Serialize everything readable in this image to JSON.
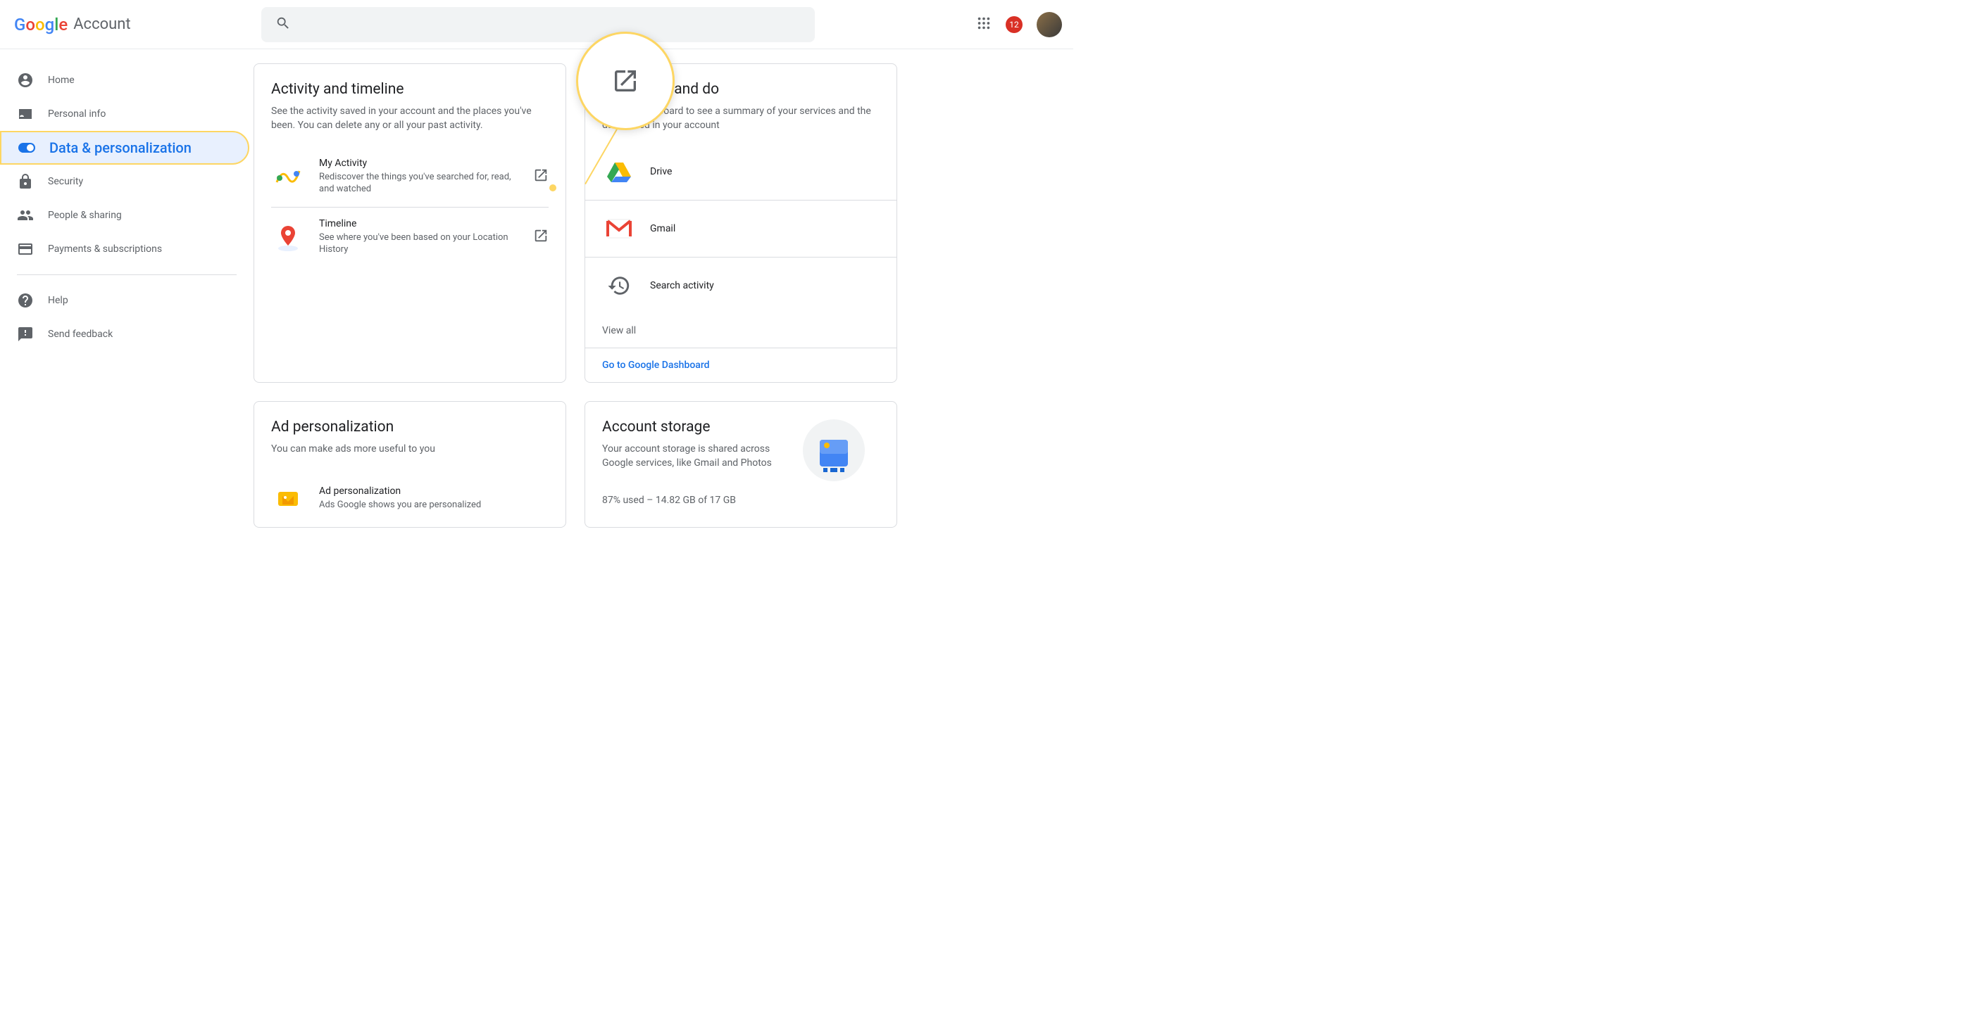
{
  "header": {
    "logo_account": "Account",
    "search_placeholder": "",
    "badge_count": "12"
  },
  "sidebar": {
    "items": [
      {
        "label": "Home"
      },
      {
        "label": "Personal info"
      },
      {
        "label": "Data & personalization"
      },
      {
        "label": "Security"
      },
      {
        "label": "People & sharing"
      },
      {
        "label": "Payments & subscriptions"
      }
    ],
    "secondary": [
      {
        "label": "Help"
      },
      {
        "label": "Send feedback"
      }
    ]
  },
  "activity_card": {
    "title": "Activity and timeline",
    "desc": "See the activity saved in your account and the places you've been. You can delete any or all your past activity.",
    "items": [
      {
        "title": "My Activity",
        "sub": "Rediscover the things you've searched for, read, and watched"
      },
      {
        "title": "Timeline",
        "sub": "See where you've been based on your Location History"
      }
    ]
  },
  "things_card": {
    "title": "you create and do",
    "desc": "Google Dashboard to see a summary of your ser­vices and the data saved in your account",
    "services": [
      {
        "label": "Drive"
      },
      {
        "label": "Gmail"
      },
      {
        "label": "Search activity"
      }
    ],
    "view_all": "View all",
    "action": "Go to Google Dashboard"
  },
  "ad_card": {
    "title": "Ad personalization",
    "desc": "You can make ads more useful to you",
    "items": [
      {
        "title": "Ad personalization",
        "sub": "Ads Google shows you are personalized"
      }
    ]
  },
  "storage_card": {
    "title": "Account storage",
    "desc": "Your account storage is shared across Google services, like Gmail and Photos",
    "usage": "87% used – 14.82 GB of 17 GB"
  }
}
